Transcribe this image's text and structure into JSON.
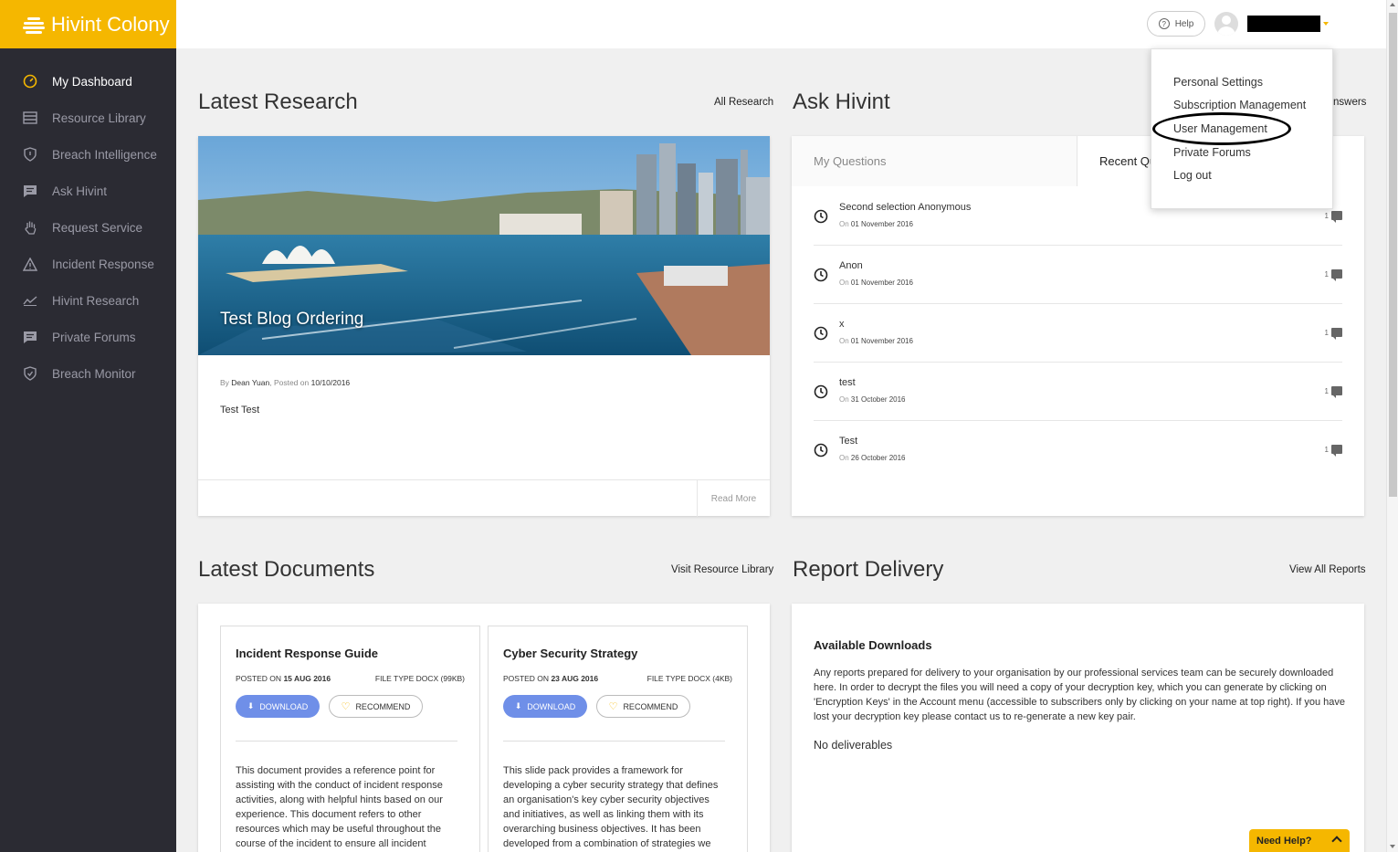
{
  "app": {
    "logo_text": "Hivint Colony"
  },
  "sidebar": {
    "items": [
      {
        "label": "My Dashboard",
        "icon": "dashboard-gauge-icon"
      },
      {
        "label": "Resource Library",
        "icon": "library-list-icon"
      },
      {
        "label": "Breach Intelligence",
        "icon": "shield-icon"
      },
      {
        "label": "Ask Hivint",
        "icon": "chat-bubble-icon"
      },
      {
        "label": "Request Service",
        "icon": "hand-icon"
      },
      {
        "label": "Incident Response",
        "icon": "warning-triangle-icon"
      },
      {
        "label": "Hivint Research",
        "icon": "trend-line-icon"
      },
      {
        "label": "Private Forums",
        "icon": "chat-bubble-icon"
      },
      {
        "label": "Breach Monitor",
        "icon": "shield-icon"
      }
    ]
  },
  "topbar": {
    "help_label": "Help",
    "user_name": ""
  },
  "user_menu": {
    "items": [
      "Personal Settings",
      "Subscription Management",
      "User Management",
      "Private Forums",
      "Log out"
    ]
  },
  "research": {
    "title": "Latest Research",
    "link": "All Research",
    "caption": "Test Blog Ordering",
    "by_prefix": "By",
    "author": "Dean Yuan",
    "posted_prefix": ", Posted on",
    "posted_date": "10/10/2016",
    "body": "Test Test",
    "read_more": "Read More"
  },
  "ask": {
    "title": "Ask Hivint",
    "link_partial": "nswers",
    "tab_my": "My Questions",
    "tab_recent": "Recent Qu",
    "questions": [
      {
        "title": "Second selection Anonymous",
        "on": "On",
        "date": "01 November 2016",
        "count": "1"
      },
      {
        "title": "Anon",
        "on": "On",
        "date": "01 November 2016",
        "count": "1"
      },
      {
        "title": "x",
        "on": "On",
        "date": "01 November 2016",
        "count": "1"
      },
      {
        "title": "test",
        "on": "On",
        "date": "31 October 2016",
        "count": "1"
      },
      {
        "title": "Test",
        "on": "On",
        "date": "26 October 2016",
        "count": "1"
      }
    ]
  },
  "documents": {
    "title": "Latest Documents",
    "link": "Visit Resource Library",
    "cards": [
      {
        "title": "Incident Response Guide",
        "posted_label": "POSTED ON",
        "posted_date": "15 AUG 2016",
        "filetype": "FILE TYPE DOCX (99KB)",
        "download": "DOWNLOAD",
        "recommend": "RECOMMEND",
        "desc": "This document provides a reference point for assisting with the conduct of incident response activities, along with helpful hints based on our experience. This document refers to other resources which may be useful throughout the course of the incident to ensure all incident"
      },
      {
        "title": "Cyber Security Strategy",
        "posted_label": "POSTED ON",
        "posted_date": "23 AUG 2016",
        "filetype": "FILE TYPE DOCX (4KB)",
        "download": "DOWNLOAD",
        "recommend": "RECOMMEND",
        "desc": "This slide pack provides a framework for developing a cyber security strategy that defines an organisation's key cyber security objectives and initiatives, as well as linking them with its overarching business objectives. It has been developed from a combination of strategies we"
      }
    ]
  },
  "report": {
    "title": "Report Delivery",
    "link": "View All Reports",
    "subtitle": "Available Downloads",
    "desc": "Any reports prepared for delivery to your organisation by our professional services team can be securely downloaded here. In order to decrypt the files you will need a copy of your decryption key, which you can generate by clicking on 'Encryption Keys' in the Account menu (accessible to subscribers only by clicking on your name at top right). If you have lost your decryption key please contact us to re-generate a new key pair.",
    "empty": "No deliverables"
  },
  "need_help": "Need Help?",
  "colors": {
    "brand": "#f5b700",
    "sidebar": "#2b2b33",
    "download_btn": "#6f8fe8"
  }
}
